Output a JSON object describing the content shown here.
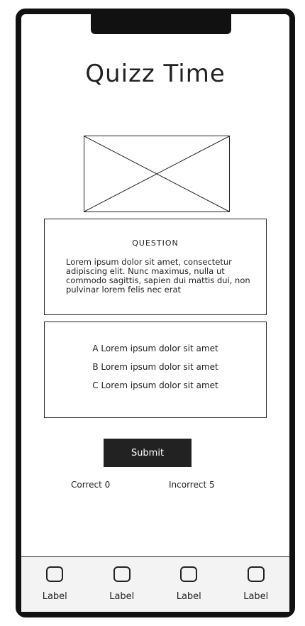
{
  "app": {
    "title": "Quizz Time"
  },
  "question": {
    "heading": "QUESTION",
    "text": "Lorem ipsum dolor sit amet, consectetur adipiscing elit. Nunc maximus, nulla ut commodo sagittis, sapien dui mattis dui, non pulvinar lorem felis nec erat"
  },
  "answers": [
    {
      "label": "A Lorem ipsum dolor sit amet"
    },
    {
      "label": "B Lorem ipsum dolor sit amet"
    },
    {
      "label": "C Lorem ipsum dolor sit amet"
    }
  ],
  "actions": {
    "submit_label": "Submit"
  },
  "score": {
    "correct": "Correct 0",
    "incorrect": "Incorrect 5"
  },
  "tabs": [
    {
      "label": "Label",
      "icon": "square-icon"
    },
    {
      "label": "Label",
      "icon": "square-icon"
    },
    {
      "label": "Label",
      "icon": "square-icon"
    },
    {
      "label": "Label",
      "icon": "square-icon"
    }
  ]
}
